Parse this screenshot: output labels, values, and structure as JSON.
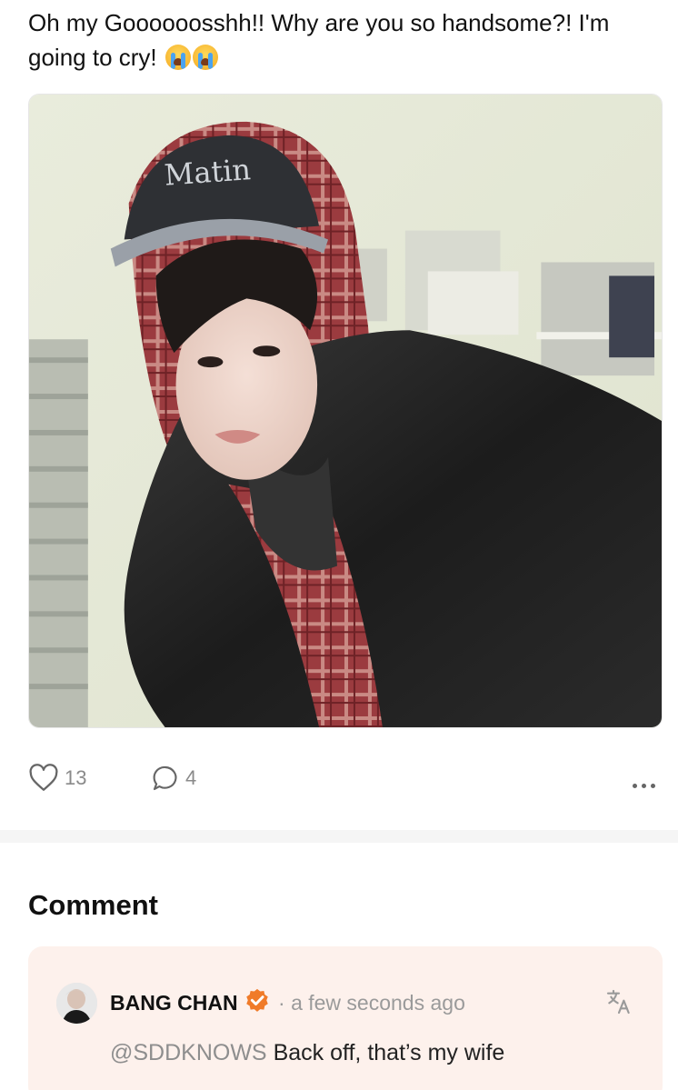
{
  "post": {
    "text": "Oh my Goooooosshh!! Why are you so handsome?! I'm going to cry!",
    "emojis": [
      "loudly-crying-face-emoji",
      "loudly-crying-face-emoji"
    ]
  },
  "photo": {
    "cap_text": "Matin"
  },
  "actions": {
    "likes": "13",
    "comments": "4"
  },
  "comments_section": {
    "title": "Comment"
  },
  "comment": {
    "author": "BANG CHAN",
    "separator": "·",
    "time": "a few seconds ago",
    "mention": "@SDDKNOWS",
    "text": "Back off, that’s my wife"
  },
  "colors": {
    "card_bg": "#fdf1ec",
    "badge": "#f07b29",
    "muted": "#8e8e8e"
  }
}
